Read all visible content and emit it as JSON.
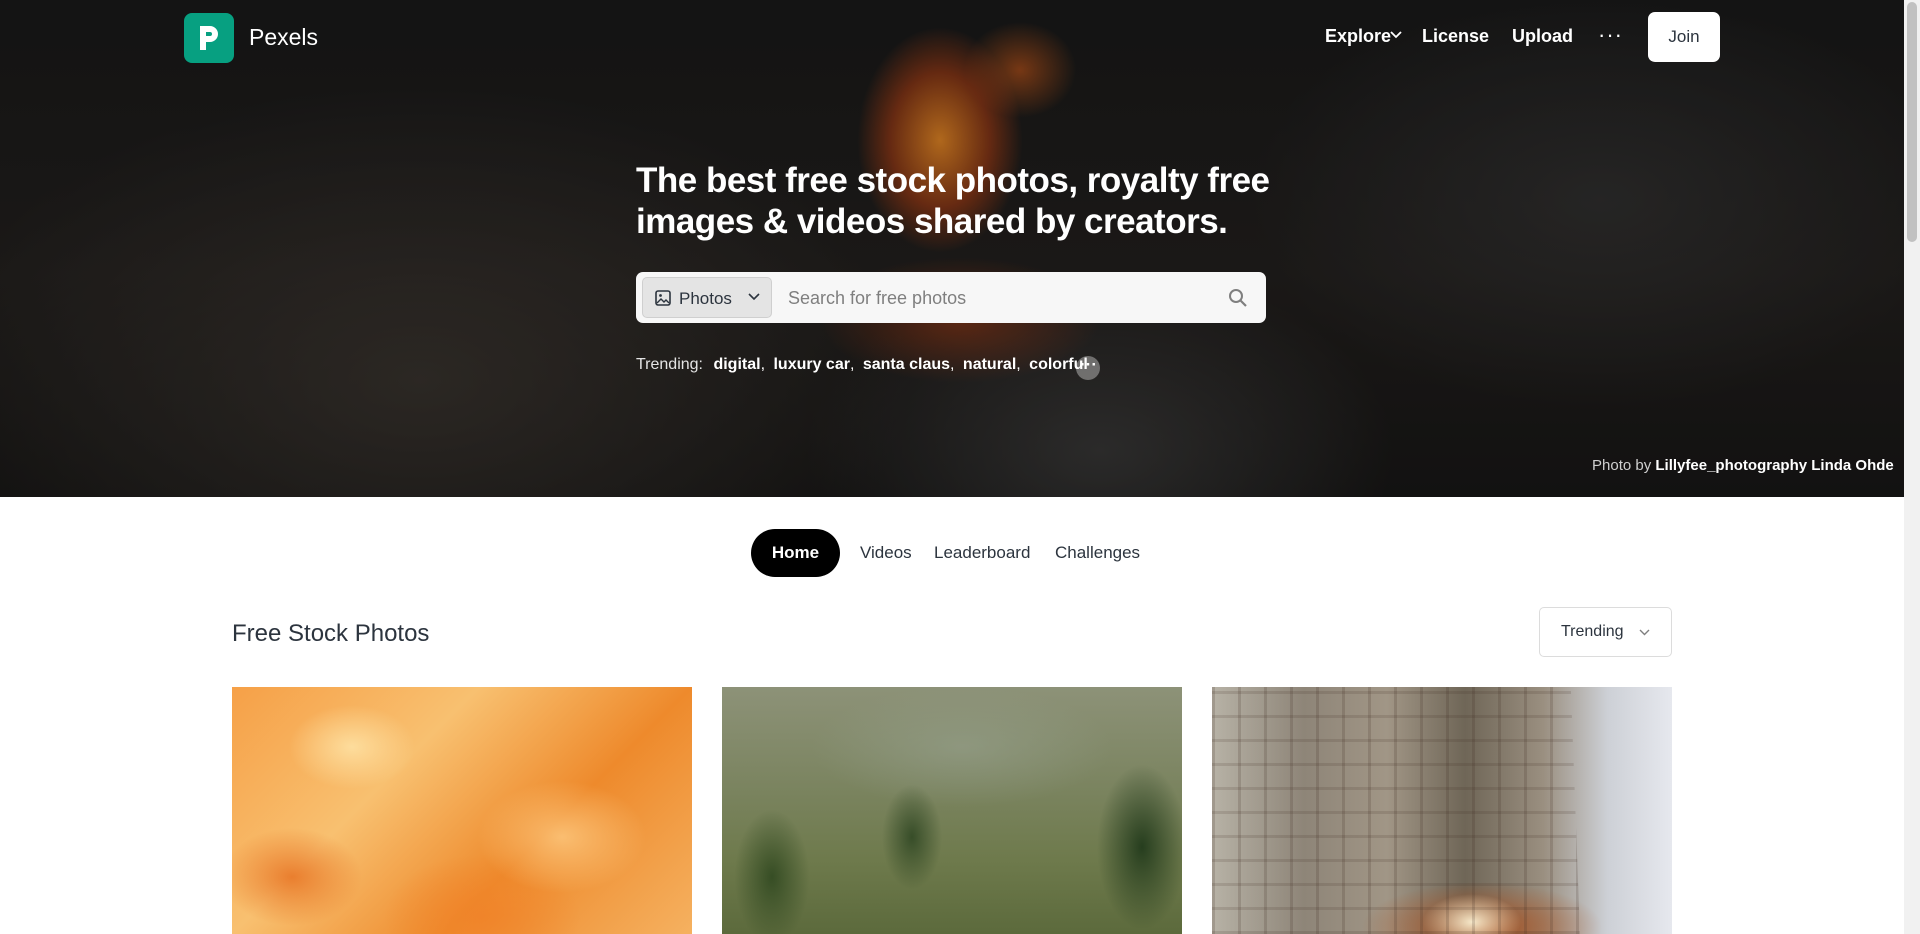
{
  "brand": {
    "name": "Pexels",
    "logo_icon": "pexels-logo-icon",
    "accent": "#07a081"
  },
  "nav": {
    "explore": "Explore",
    "license": "License",
    "upload": "Upload",
    "more": "···",
    "join": "Join"
  },
  "hero": {
    "title": "The best free stock photos, royalty free images & videos shared by creators.",
    "search": {
      "type_label": "Photos",
      "placeholder": "Search for free photos"
    },
    "trending": {
      "label": "Trending:",
      "terms": [
        "digital",
        "luxury car",
        "santa claus",
        "natural",
        "colorful"
      ],
      "separator": ","
    },
    "credit": {
      "prefix": "Photo by",
      "author": "Lillyfee_photography Linda Ohde"
    }
  },
  "tabs": {
    "home": "Home",
    "videos": "Videos",
    "leaderboard": "Leaderboard",
    "challenges": "Challenges"
  },
  "section": {
    "title": "Free Stock Photos",
    "sort": "Trending"
  }
}
